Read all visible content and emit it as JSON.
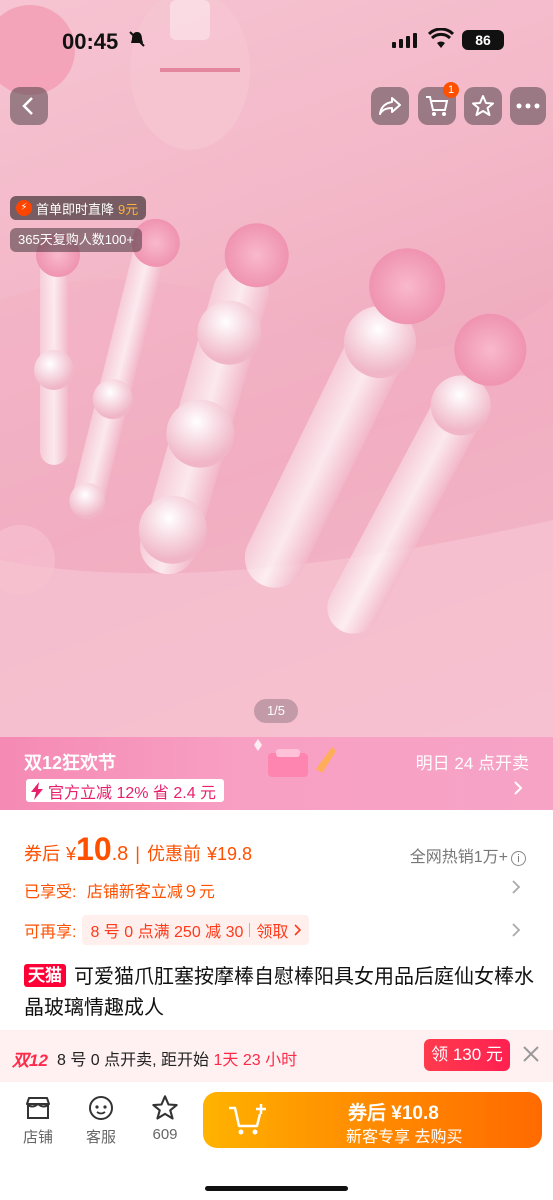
{
  "status": {
    "time": "00:45",
    "battery": "86"
  },
  "nav": {
    "cart_badge": "1"
  },
  "hero": {
    "promo_label": "首单即时直降",
    "promo_amount": "9元",
    "repurchase": "365天复购人数100+",
    "pager": "1/5"
  },
  "festival": {
    "title": "双12狂欢节",
    "open_time": "明日 24 点开卖",
    "discount": "官方立减 12% 省 2.4 元"
  },
  "price": {
    "label": "券后",
    "yen": "¥",
    "integer": "10",
    "decimal": ".8",
    "orig_label": "优惠前",
    "orig_price": "¥19.8",
    "sales": "全网热销1万+"
  },
  "benefits": {
    "enjoyed_key": "已享受:",
    "enjoyed_value": "店铺新客立减９元",
    "available_key": "可再享:",
    "coupon_text": "8 号 0 点满 250 减 30",
    "coupon_action": "领取"
  },
  "product": {
    "badge": "天猫",
    "title": "可爱猫爪肛塞按摩棒自慰棒阳具女用品后庭仙女棒水晶玻璃情趣成人"
  },
  "countdown": {
    "tag": "双12",
    "text_pre": "8 号 0 点开卖, 距开始",
    "remaining": "1天 23 小时",
    "claim": "领 130 元"
  },
  "bottom": {
    "store": "店铺",
    "service": "客服",
    "fav_count": "609",
    "buy_line1": "券后 ¥10.8",
    "buy_line2": "新客专享  去购买"
  }
}
